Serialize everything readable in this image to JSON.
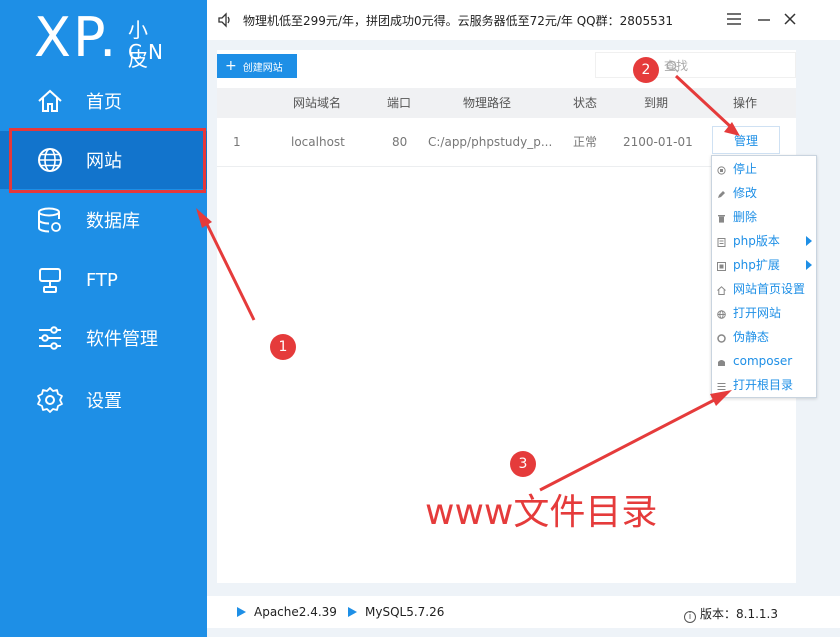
{
  "logo": {
    "main": "XP.",
    "small": "小皮",
    "cn": "CN"
  },
  "sidebar": {
    "items": [
      {
        "label": "首页",
        "icon": "home-icon"
      },
      {
        "label": "网站",
        "icon": "globe-icon"
      },
      {
        "label": "数据库",
        "icon": "database-icon"
      },
      {
        "label": "FTP",
        "icon": "ftp-icon"
      },
      {
        "label": "软件管理",
        "icon": "sliders-icon"
      },
      {
        "label": "设置",
        "icon": "gear-icon"
      }
    ]
  },
  "topbar": {
    "notice": "物理机低至299元/年，拼团成功0元得。云服务器低至72元/年  QQ群：2805531"
  },
  "toolbar": {
    "create_label": "创建网站",
    "search_placeholder": "查找"
  },
  "table": {
    "headers": [
      "网站域名",
      "端口",
      "物理路径",
      "状态",
      "到期",
      "操作"
    ],
    "rows": [
      {
        "index": "1",
        "domain": "localhost",
        "port": "80",
        "path": "C:/app/phpstudy_p...",
        "status": "正常",
        "expire": "2100-01-01",
        "action": "管理"
      }
    ]
  },
  "menu": {
    "items": [
      {
        "label": "停止",
        "icon": "stop-icon",
        "submenu": false
      },
      {
        "label": "修改",
        "icon": "edit-icon",
        "submenu": false
      },
      {
        "label": "删除",
        "icon": "trash-icon",
        "submenu": false
      },
      {
        "label": "php版本",
        "icon": "file-icon",
        "submenu": true
      },
      {
        "label": "php扩展",
        "icon": "extension-icon",
        "submenu": true
      },
      {
        "label": "网站首页设置",
        "icon": "home-icon",
        "submenu": false
      },
      {
        "label": "打开网站",
        "icon": "globe-icon",
        "submenu": false
      },
      {
        "label": "伪静态",
        "icon": "rewrite-icon",
        "submenu": false
      },
      {
        "label": "composer",
        "icon": "composer-icon",
        "submenu": false
      },
      {
        "label": "打开根目录",
        "icon": "list-icon",
        "submenu": false
      }
    ]
  },
  "statusbar": {
    "apache": "Apache2.4.39",
    "mysql": "MySQL5.7.26",
    "version": "版本：8.1.1.3"
  },
  "annotations": {
    "num1": "1",
    "num2": "2",
    "num3": "3",
    "text": "www文件目录"
  },
  "colors": {
    "accent": "#1e8fe6",
    "annotation": "#e53b3b",
    "sidebar_active": "#1274cc"
  }
}
